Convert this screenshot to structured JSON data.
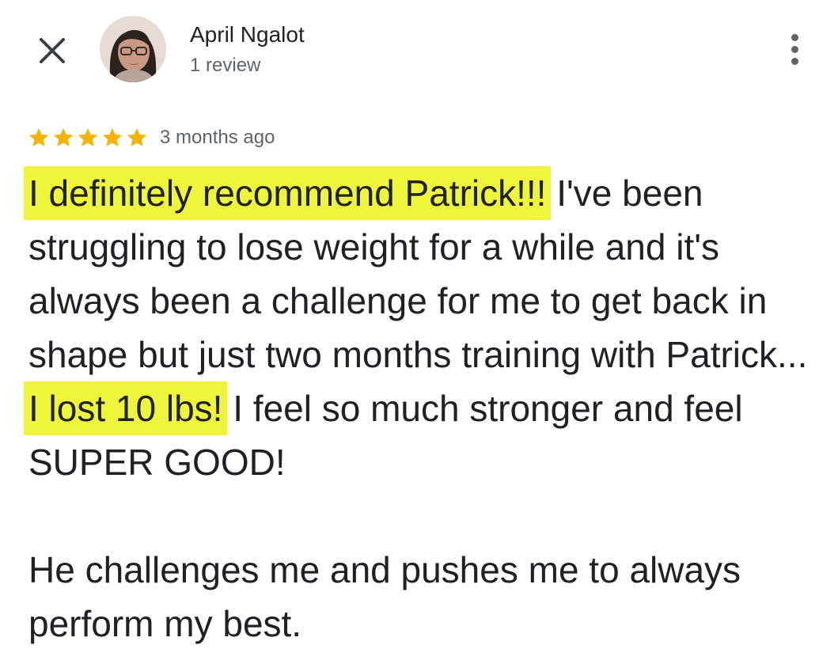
{
  "header": {
    "reviewer_name": "April Ngalot",
    "review_count": "1 review",
    "close_icon": "close-icon",
    "more_icon": "more-vert-icon"
  },
  "rating": {
    "stars": 5,
    "max_stars": 5,
    "star_color": "#f4b400",
    "time_ago": "3 months ago"
  },
  "review": {
    "p1_highlight_1": "I definitely recommend Patrick!!!",
    "p1_text_1": " I've been struggling to lose weight for a while and it's always been a challenge for me to get back in shape but just two months training with Patrick... ",
    "p1_highlight_2": "I lost 10 lbs!",
    "p1_text_2": " I feel so much stronger and feel SUPER GOOD!",
    "p2": "He challenges me and pushes me to always perform my best."
  },
  "colors": {
    "highlight": "#eef53a",
    "text": "#202124",
    "secondary_text": "#5f6368"
  }
}
